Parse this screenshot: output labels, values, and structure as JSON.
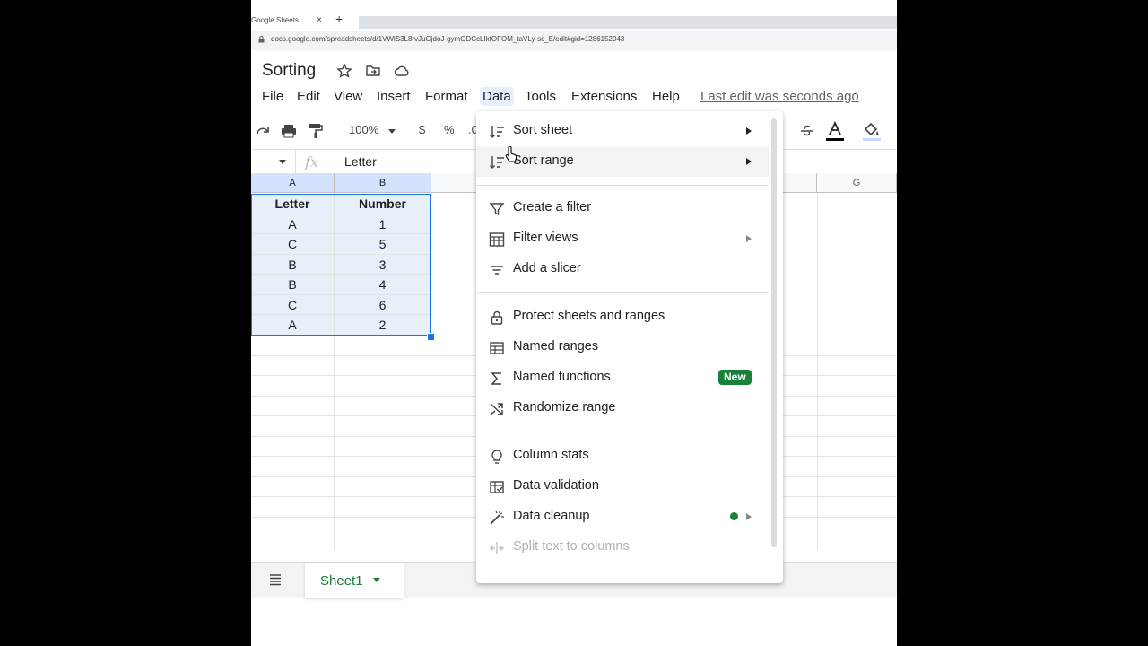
{
  "browser": {
    "tab_title": "Google Sheets",
    "tab_close": "×",
    "new_tab": "+",
    "url": "docs.google.com/spreadsheets/d/1VWlS3L8rvJuGjdoJ-gymODCcLIkfOFOM_taVLy-sc_E/edit#gid=1286152043"
  },
  "doc": {
    "title": "Sorting",
    "last_edit": "Last edit was seconds ago"
  },
  "menubar": [
    "File",
    "Edit",
    "View",
    "Insert",
    "Format",
    "Data",
    "Tools",
    "Extensions",
    "Help"
  ],
  "toolbar": {
    "zoom": "100%",
    "currency": "$",
    "percent": "%",
    "decimal": ".0"
  },
  "formula_bar": {
    "fx": "fx",
    "value": "Letter"
  },
  "sheet": {
    "columns": [
      "A",
      "B",
      "G"
    ],
    "header": [
      "Letter",
      "Number"
    ],
    "rows": [
      [
        "A",
        "1"
      ],
      [
        "C",
        "5"
      ],
      [
        "B",
        "3"
      ],
      [
        "B",
        "4"
      ],
      [
        "C",
        "6"
      ],
      [
        "A",
        "2"
      ]
    ]
  },
  "sheet_tabs": {
    "active": "Sheet1"
  },
  "data_menu": {
    "items": [
      {
        "label": "Sort sheet",
        "icon": "sort-icon",
        "submenu": true
      },
      {
        "label": "Sort range",
        "icon": "sort-icon",
        "submenu": true
      },
      {
        "label": "Create a filter",
        "icon": "filter-icon"
      },
      {
        "label": "Filter views",
        "icon": "filter-views-icon",
        "submenu": true
      },
      {
        "label": "Add a slicer",
        "icon": "slicer-icon"
      },
      {
        "label": "Protect sheets and ranges",
        "icon": "lock-icon"
      },
      {
        "label": "Named ranges",
        "icon": "named-ranges-icon"
      },
      {
        "label": "Named functions",
        "icon": "sigma-icon",
        "badge": "New"
      },
      {
        "label": "Randomize range",
        "icon": "shuffle-icon"
      },
      {
        "label": "Column stats",
        "icon": "lightbulb-icon"
      },
      {
        "label": "Data validation",
        "icon": "data-validation-icon"
      },
      {
        "label": "Data cleanup",
        "icon": "magic-wand-icon",
        "submenu": true
      },
      {
        "label": "Split text to columns",
        "icon": "split-icon",
        "disabled": true
      }
    ]
  },
  "colors": {
    "accent": "#1a73e8",
    "green": "#188038",
    "selection_fill": "#e7eff8"
  }
}
